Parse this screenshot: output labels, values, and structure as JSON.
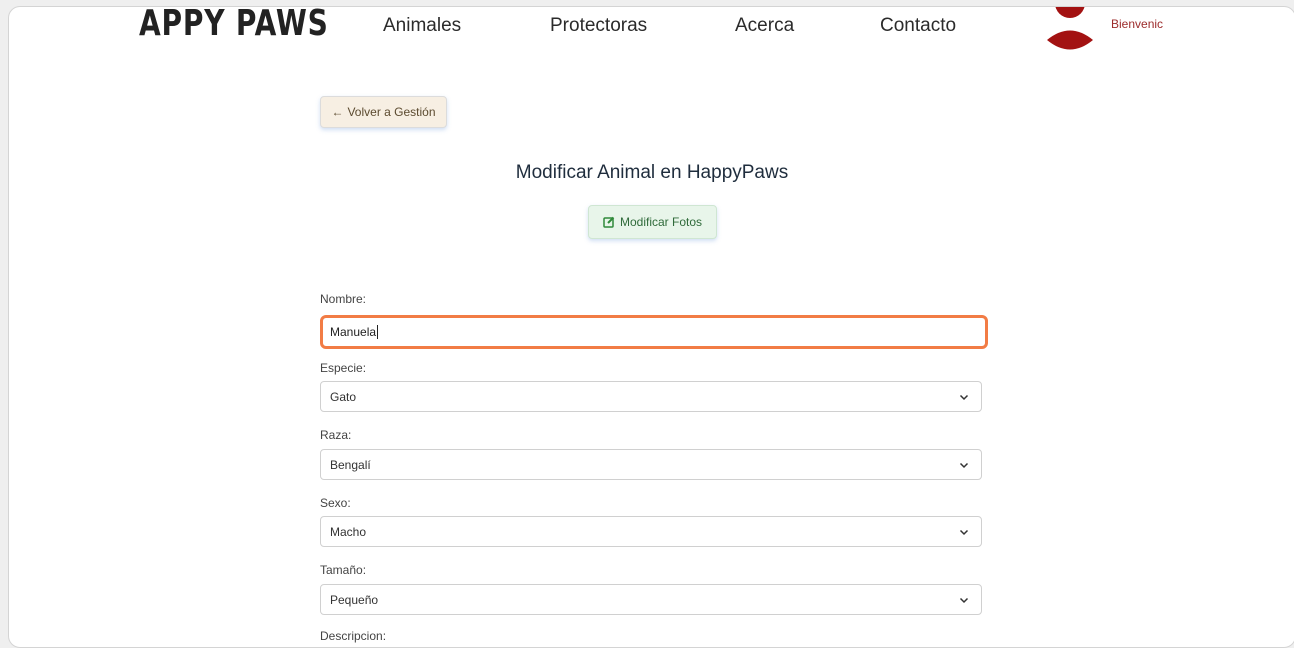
{
  "header": {
    "brand": "APPY PAWS",
    "nav": [
      "Animales",
      "Protectoras",
      "Acerca",
      "Contacto"
    ],
    "welcome": "Bienvenic",
    "avatar_color": "#a31212"
  },
  "back_button": {
    "label": "Volver a Gestión",
    "icon": "arrow-left-icon"
  },
  "title": "Modificar Animal en HappyPaws",
  "photos_button": {
    "label": "Modificar Fotos",
    "icon": "edit-icon",
    "color": "#2f8a3a"
  },
  "form": {
    "nombre": {
      "label": "Nombre:",
      "value": "Manuela",
      "focus_color": "#f27c45"
    },
    "especie": {
      "label": "Especie:",
      "value": "Gato"
    },
    "raza": {
      "label": "Raza:",
      "value": "Bengalí"
    },
    "sexo": {
      "label": "Sexo:",
      "value": "Macho"
    },
    "tamano": {
      "label": "Tamaño:",
      "value": "Pequeño"
    },
    "descripcion": {
      "label": "Descripcion:"
    }
  }
}
